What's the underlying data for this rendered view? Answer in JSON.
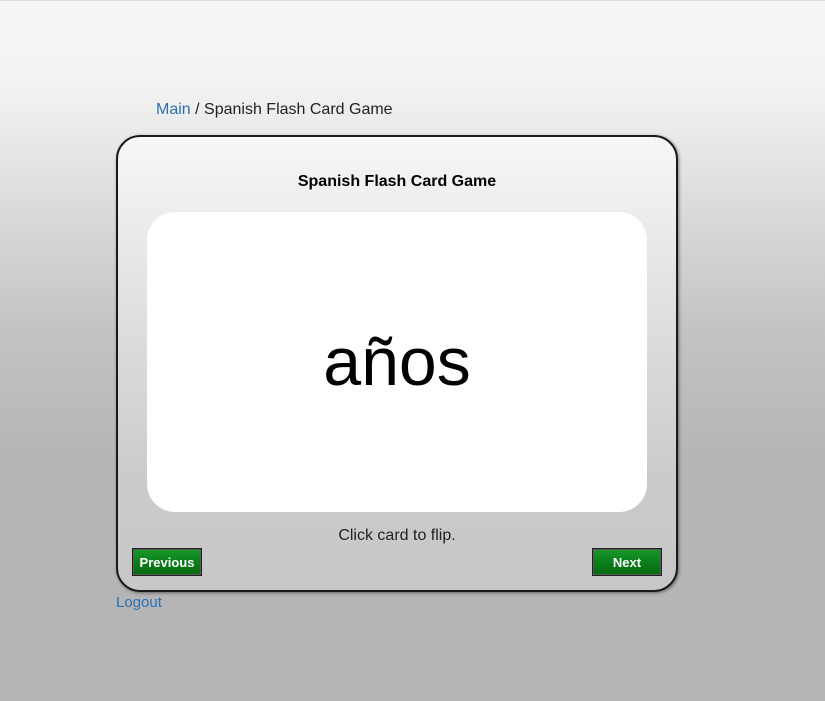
{
  "breadcrumb": {
    "home_label": "Main",
    "separator": " / ",
    "current_label": "Spanish Flash Card Game"
  },
  "game": {
    "title": "Spanish Flash Card Game",
    "card_word": "años",
    "hint": "Click card to flip.",
    "previous_label": "Previous",
    "next_label": "Next"
  },
  "footer": {
    "logout_label": "Logout"
  },
  "colors": {
    "link": "#2a72b5",
    "button_green": "#0b7e1b",
    "card_background": "#ffffff"
  }
}
